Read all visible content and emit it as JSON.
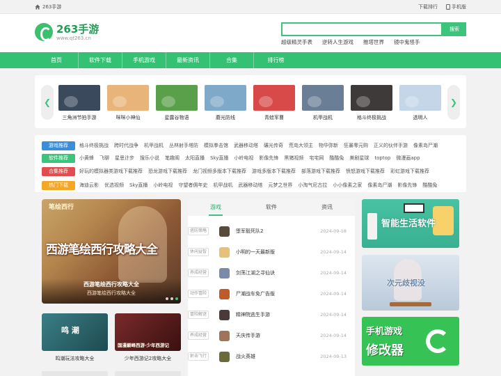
{
  "topbar": {
    "home_label": "263手游",
    "links": [
      "下载排行",
      "手机版"
    ]
  },
  "header": {
    "brand": "263手游",
    "url": "www.qt263.cn"
  },
  "search": {
    "value": "",
    "placeholder": "",
    "button": "搜索",
    "hot_words": [
      "超级精灵手表",
      "逆转人生游戏",
      "推塔世界",
      "镜中鬼怪手"
    ]
  },
  "nav": {
    "items": [
      "首页",
      "软件下载",
      "手机游戏",
      "最新资讯",
      "合集",
      "排行榜"
    ]
  },
  "slider": {
    "games": [
      {
        "name": "三角洲节拍手游",
        "color": "#3a4a5c"
      },
      {
        "name": "咪咪小神仙",
        "color": "#e8b47a"
      },
      {
        "name": "星露谷物语",
        "color": "#5aa04a"
      },
      {
        "name": "蘑光防线",
        "color": "#7fa9c9"
      },
      {
        "name": "青蛙军曹",
        "color": "#d84a4a"
      },
      {
        "name": "机甲战机",
        "color": "#6a7f95"
      },
      {
        "name": "格斗终极挑战",
        "color": "#3f3a3a"
      },
      {
        "name": "透明人",
        "color": "#c4d6e8"
      }
    ]
  },
  "tags": {
    "rows": [
      {
        "label": "游戏推荐",
        "color": "#3b8cd9",
        "words": [
          "格斗终极挑战",
          "跨时代战争",
          "机甲战机",
          "丛林射手塔防",
          "模拟拳击馆",
          "武器移动塔",
          "碾光传奇",
          "荒岛大领主",
          "物华弥新",
          "狂暴零元购",
          "正义的伙伴手游",
          "像素岛尸潮"
        ]
      },
      {
        "label": "软件推荐",
        "color": "#3cc47c",
        "words": [
          "小黄蜂",
          "飞聊",
          "星思计步",
          "搜乐小说",
          "笔趣阁",
          "太阳直播",
          "Sky直播",
          "小岭电视",
          "影像先锋",
          "黑猪视频",
          "宅宅网",
          "酷酷兔",
          "美剧星球",
          "toptop",
          "微漫画app"
        ]
      },
      {
        "label": "合集推荐",
        "color": "#e34d4d",
        "words": [
          "好玩的模拟器类游戏下载推荐",
          "恐龙游戏下载推荐",
          "龙门视频多版本下载推荐",
          "游戏多版本下载推荐",
          "部落游戏下载推荐",
          "愤怒游戏下载推荐",
          "彩虹游戏下载推荐"
        ]
      },
      {
        "label": "热门下载",
        "color": "#f5a623",
        "words": [
          "海迪云影",
          "优选视频",
          "Sky直播",
          "小岭电视",
          "守望者佣年史",
          "机甲战机",
          "武器移动塔",
          "元梦之世界",
          "小淘气尼古拉",
          "小小像素之家",
          "像素岛尸潮",
          "影像先锋",
          "酷酷兔"
        ]
      }
    ]
  },
  "banner": {
    "logo": "笔绘西行",
    "title": "西游笔绘西行攻略大全",
    "caption": "西游笔绘西行攻略大全",
    "caption2": "西游笔绘西行攻略大全"
  },
  "minis": [
    {
      "caption": "鸣潮玩法攻略大全",
      "art": "鸣 潮",
      "color": "#3a7f86"
    },
    {
      "caption": "少年西游记2攻略大全",
      "art": "国漫巅峰西游·少年西游记",
      "color": "#7a2a2a"
    }
  ],
  "list": {
    "tabs": [
      "游戏",
      "软件",
      "资讯"
    ],
    "active_tab": 0,
    "rows": [
      {
        "cat": "塔防策略",
        "name": "堕军毅死队2",
        "date": "2024-09-18",
        "color": "#5a4a3a"
      },
      {
        "cat": "休闲益智",
        "name": "小明的一天最新版",
        "date": "2024-09-14",
        "color": "#e8c07a"
      },
      {
        "cat": "养成经营",
        "name": "剑荡江湖之寻仙诀",
        "date": "2024-09-14",
        "color": "#7a8aa8"
      },
      {
        "cat": "动作冒险",
        "name": "尸潮战车免广告版",
        "date": "2024-09-14",
        "color": "#c05a2a"
      },
      {
        "cat": "冒险解谜",
        "name": "精神院逃生手游",
        "date": "2024-09-14",
        "color": "#4a3a3a"
      },
      {
        "cat": "养成经营",
        "name": "天庆传手游",
        "date": "2024-09-14",
        "color": "#a0735a"
      },
      {
        "cat": "射击飞行",
        "name": "战火英雄",
        "date": "2024-09-13",
        "color": "#6a6a3a"
      }
    ]
  },
  "ads": [
    {
      "text": "智能生活软件"
    },
    {
      "text": "次元歧视没"
    },
    {
      "line1": "手机游戏",
      "line2": "修改器"
    }
  ]
}
